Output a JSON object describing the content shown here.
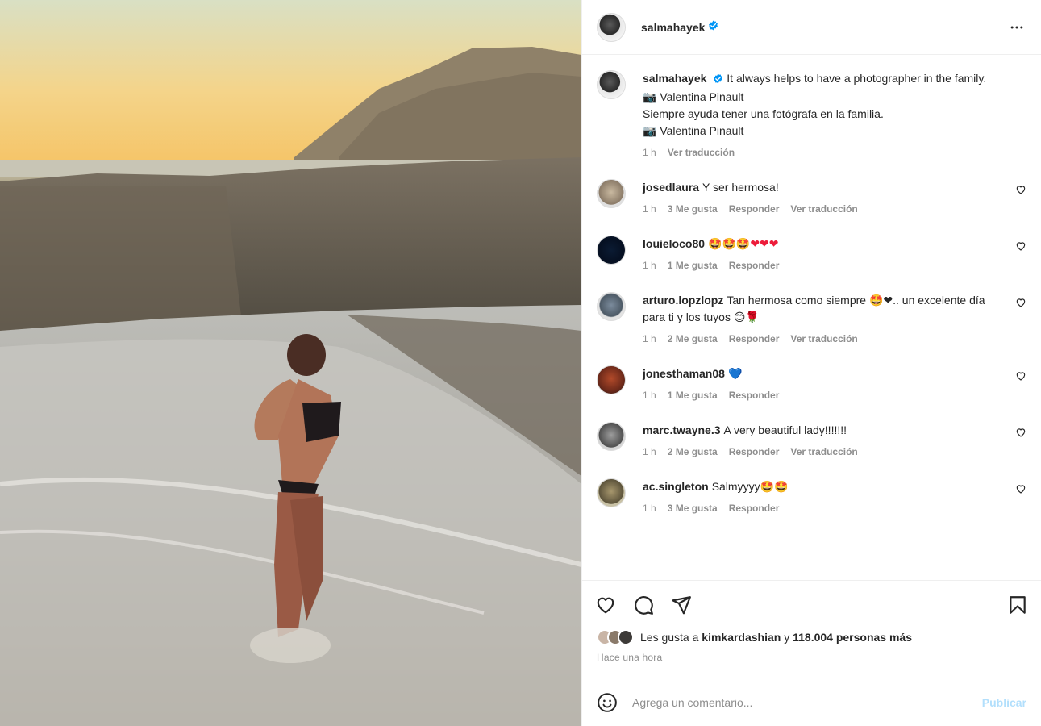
{
  "photo": {
    "icon": "beach-photo"
  },
  "header": {
    "username": "salmahayek",
    "verified": true,
    "more_icon": "more-horizontal-icon"
  },
  "caption": {
    "username": "salmahayek",
    "lines": [
      "It always helps to have a photographer in the family.",
      "📷 Valentina Pinault",
      "Siempre ayuda tener una fotógrafa en la familia.",
      "📷 Valentina Pinault"
    ],
    "time": "1 h",
    "translate": "Ver traducción"
  },
  "comments": [
    {
      "username": "josedlaura",
      "text": "Y ser hermosa!",
      "time": "1 h",
      "likes": "3 Me gusta",
      "reply": "Responder",
      "translate": "Ver traducción"
    },
    {
      "username": "louieloco80",
      "text": "🤩🤩🤩❤❤❤",
      "time": "1 h",
      "likes": "1 Me gusta",
      "reply": "Responder",
      "translate": ""
    },
    {
      "username": "arturo.lopzlopz",
      "text": "Tan hermosa como siempre 🤩❤.. un excelente día para ti y los tuyos 😊🌹",
      "time": "1 h",
      "likes": "2 Me gusta",
      "reply": "Responder",
      "translate": "Ver traducción"
    },
    {
      "username": "jonesthaman08",
      "text": "💙",
      "time": "1 h",
      "likes": "1 Me gusta",
      "reply": "Responder",
      "translate": ""
    },
    {
      "username": "marc.twayne.3",
      "text": "A very beautiful lady!!!!!!!",
      "time": "1 h",
      "likes": "2 Me gusta",
      "reply": "Responder",
      "translate": "Ver traducción"
    },
    {
      "username": "ac.singleton",
      "text": "Salmyyyy🤩🤩",
      "time": "1 h",
      "likes": "3 Me gusta",
      "reply": "Responder",
      "translate": ""
    }
  ],
  "actions": {
    "like_icon": "heart-icon",
    "comment_icon": "comment-icon",
    "share_icon": "send-icon",
    "save_icon": "bookmark-icon"
  },
  "likes": {
    "prefix": "Les gusta a",
    "user": "kimkardashian",
    "connector": "y",
    "others": "118.004 personas más"
  },
  "posted": "Hace una hora",
  "composer": {
    "placeholder": "Agrega un comentario...",
    "post_label": "Publicar",
    "emoji_icon": "smiley-icon"
  },
  "colors": {
    "verified": "#0095f6",
    "muted": "#8e8e8e",
    "post_disabled": "#b2dffc"
  }
}
